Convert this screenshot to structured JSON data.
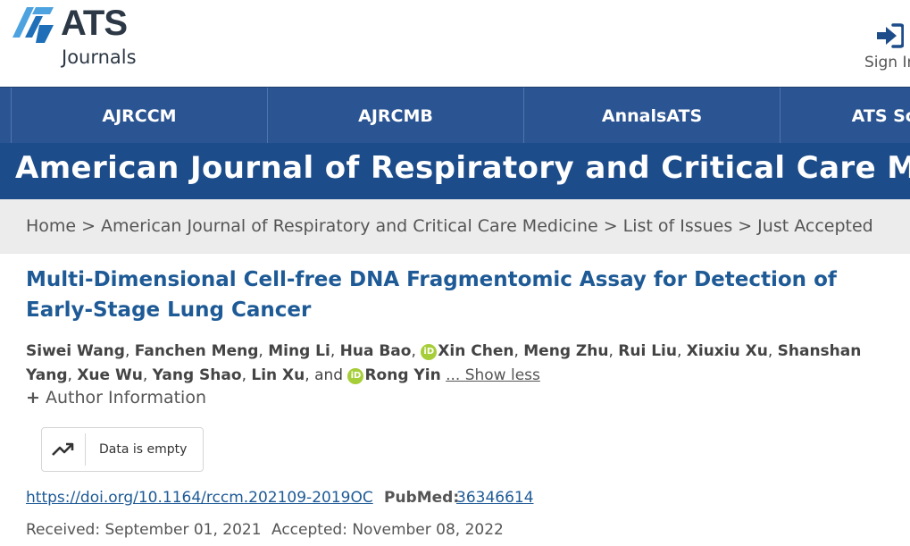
{
  "header": {
    "logo_wordmark": "ATS",
    "logo_subtext": "Journals",
    "signin_label": "Sign In",
    "brand_colors": {
      "dark_blue": "#1d4c8a",
      "nav_blue": "#2b5492",
      "logo_light": "#4da3e0",
      "logo_dark": "#1f6fb8"
    }
  },
  "journal_nav": {
    "tabs": [
      {
        "label": "AJRCCM"
      },
      {
        "label": "AJRCMB"
      },
      {
        "label": "AnnalsATS"
      },
      {
        "label": "ATS Scholar"
      }
    ]
  },
  "journal_title": "American Journal of Respiratory and Critical Care Medicine",
  "breadcrumb": {
    "items": [
      {
        "label": "Home"
      },
      {
        "label": "American Journal of Respiratory and Critical Care Medicine"
      },
      {
        "label": "List of Issues"
      },
      {
        "label": "Just Accepted"
      }
    ],
    "separator": ">"
  },
  "article": {
    "title": "Multi-Dimensional Cell-free DNA Fragmentomic Assay for Detection of Early-Stage Lung Cancer",
    "authors": [
      {
        "name": "Siwei Wang",
        "orcid": false
      },
      {
        "name": "Fanchen Meng",
        "orcid": false
      },
      {
        "name": "Ming Li",
        "orcid": false
      },
      {
        "name": "Hua Bao",
        "orcid": false
      },
      {
        "name": "Xin Chen",
        "orcid": true
      },
      {
        "name": "Meng Zhu",
        "orcid": false
      },
      {
        "name": "Rui Liu",
        "orcid": false
      },
      {
        "name": "Xiuxiu Xu",
        "orcid": false
      },
      {
        "name": "Shanshan Yang",
        "orcid": false
      },
      {
        "name": "Xue Wu",
        "orcid": false
      },
      {
        "name": "Yang Shao",
        "orcid": false
      },
      {
        "name": "Lin Xu",
        "orcid": false
      },
      {
        "name": "Rong Yin",
        "orcid": true
      }
    ],
    "and_word": "and",
    "show_less": "... Show less",
    "orcid_badge": "iD",
    "author_info_toggle": "+",
    "author_info_label": "Author Information",
    "metrics_icon": "trending-up-icon",
    "metrics_text": "Data is empty",
    "doi": "https://doi.org/10.1164/rccm.202109-2019OC",
    "pubmed_label": "PubMed:",
    "pubmed_id": "36346614",
    "received": "Received: September 01, 2021",
    "accepted": "Accepted: November 08, 2022"
  }
}
